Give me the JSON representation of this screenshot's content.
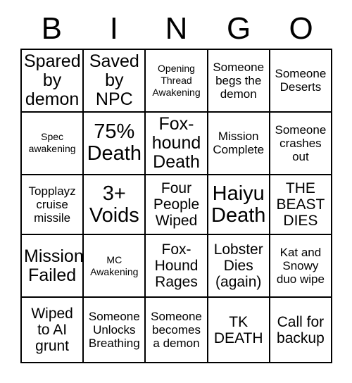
{
  "header": {
    "letters": [
      "B",
      "I",
      "N",
      "G",
      "O"
    ]
  },
  "grid": {
    "columns": 5,
    "rows": 5,
    "cells": [
      [
        {
          "text": "Spared\nby\ndemon",
          "size": "sz-lg",
          "marked": false
        },
        {
          "text": "Saved\nby\nNPC",
          "size": "sz-lg",
          "marked": false
        },
        {
          "text": "Opening\nThread\nAwakening",
          "size": "sz-xs",
          "marked": false
        },
        {
          "text": "Someone\nbegs the\ndemon",
          "size": "sz-sm",
          "marked": false
        },
        {
          "text": "Someone\nDeserts",
          "size": "sz-sm",
          "marked": false
        }
      ],
      [
        {
          "text": "Spec\nawakening",
          "size": "sz-xs",
          "marked": false
        },
        {
          "text": "75%\nDeath",
          "size": "sz-xl",
          "marked": false
        },
        {
          "text": "Fox-\nhound\nDeath",
          "size": "sz-lg",
          "marked": false
        },
        {
          "text": "Mission\nComplete",
          "size": "sz-sm",
          "marked": false
        },
        {
          "text": "Someone\ncrashes\nout",
          "size": "sz-sm",
          "marked": false
        }
      ],
      [
        {
          "text": "Topplayz\ncruise\nmissile",
          "size": "sz-sm",
          "marked": false
        },
        {
          "text": "3+\nVoids",
          "size": "sz-xl",
          "marked": false
        },
        {
          "text": "Four\nPeople\nWiped",
          "size": "sz-md",
          "marked": false
        },
        {
          "text": "Haiyu\nDeath",
          "size": "sz-xl",
          "marked": false
        },
        {
          "text": "THE\nBEAST\nDIES",
          "size": "sz-md",
          "marked": false
        }
      ],
      [
        {
          "text": "Mission\nFailed",
          "size": "sz-lg",
          "marked": false
        },
        {
          "text": "MC\nAwakening",
          "size": "sz-xs",
          "marked": false
        },
        {
          "text": "Fox-\nHound\nRages",
          "size": "sz-md",
          "marked": false
        },
        {
          "text": "Lobster\nDies\n(again)",
          "size": "sz-md",
          "marked": false
        },
        {
          "text": "Kat and\nSnowy\nduo wipe",
          "size": "sz-sm",
          "marked": false
        }
      ],
      [
        {
          "text": "Wiped\nto AI\ngrunt",
          "size": "sz-md",
          "marked": false
        },
        {
          "text": "Someone\nUnlocks\nBreathing",
          "size": "sz-sm",
          "marked": false
        },
        {
          "text": "Someone\nbecomes\na demon",
          "size": "sz-sm",
          "marked": false
        },
        {
          "text": "TK\nDEATH",
          "size": "sz-md",
          "marked": false
        },
        {
          "text": "Call for\nbackup",
          "size": "sz-md",
          "marked": false
        }
      ]
    ]
  },
  "colors": {
    "background": "#ffffff",
    "border": "#000000",
    "text": "#000000"
  }
}
